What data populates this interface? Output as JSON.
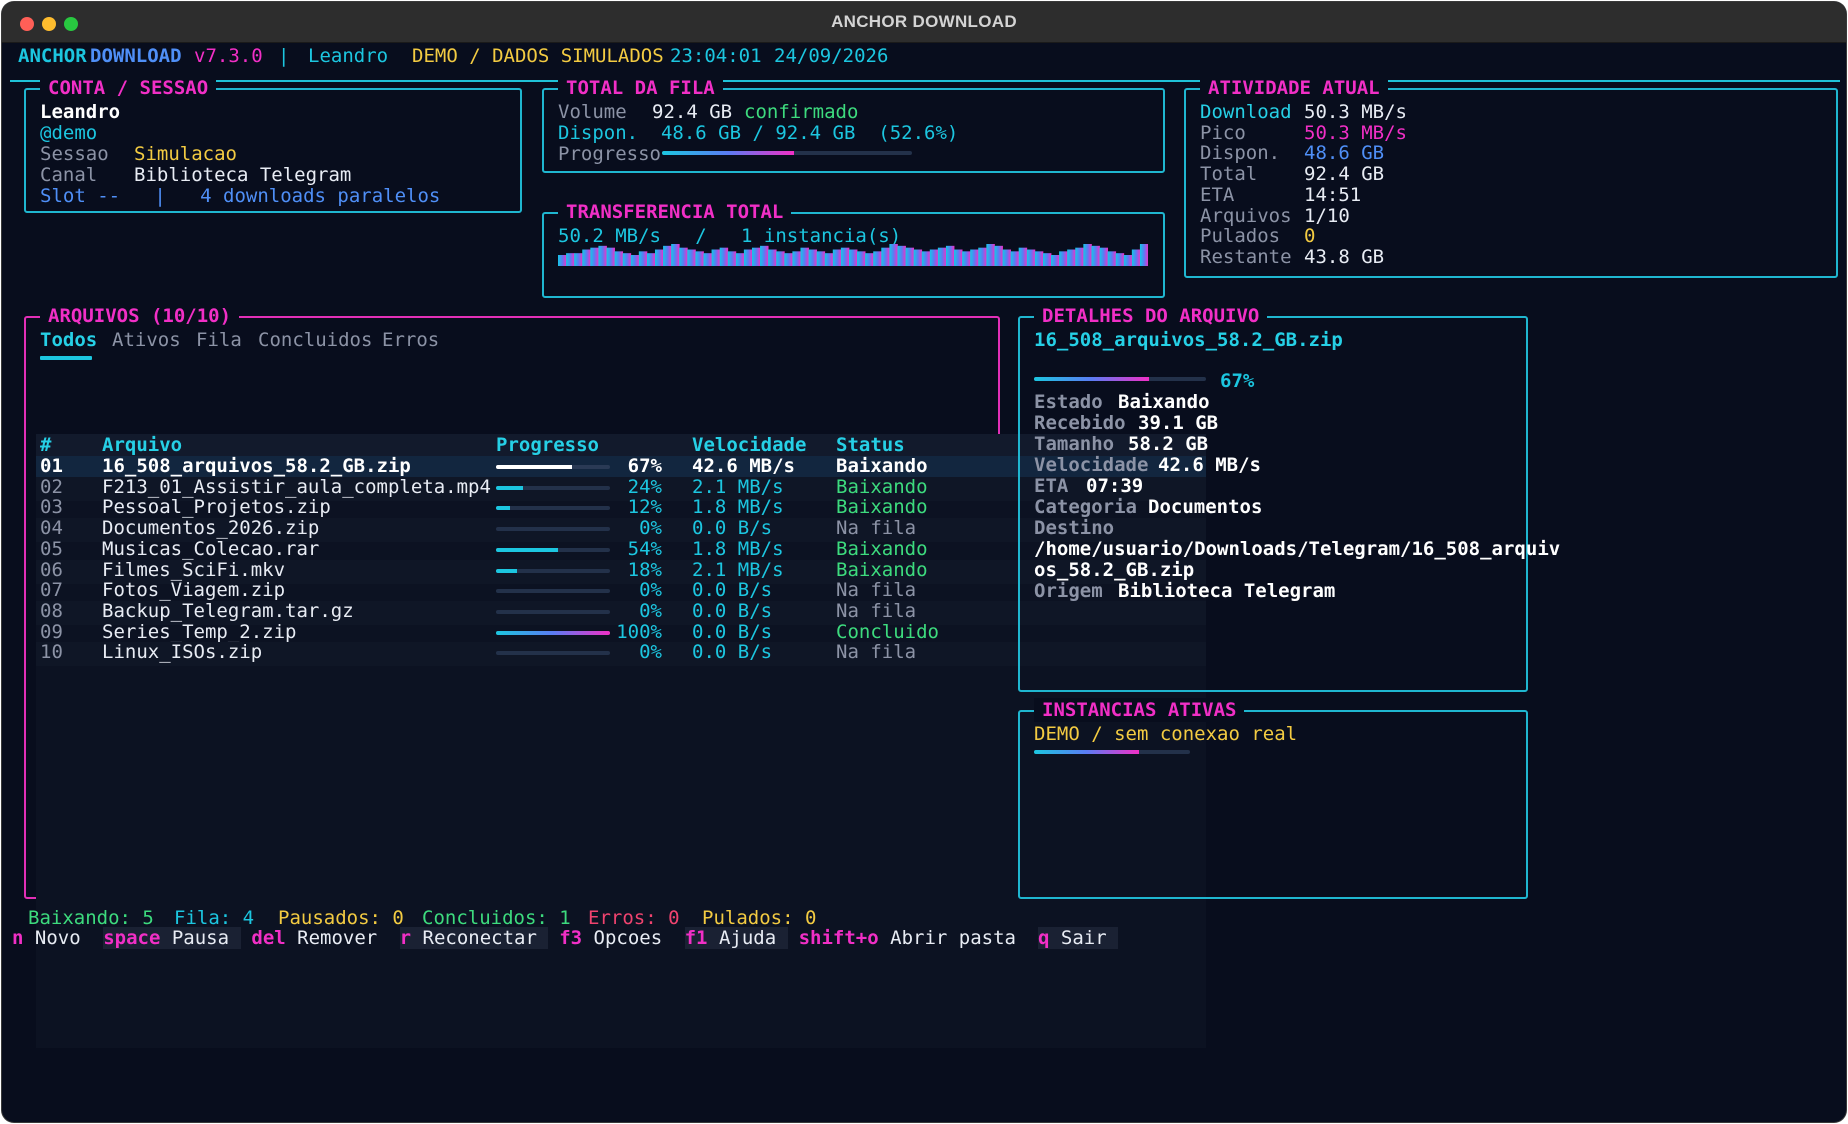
{
  "window": {
    "title": "ANCHOR DOWNLOAD"
  },
  "header": {
    "app_word1": "ANCHOR",
    "app_word2": "DOWNLOAD",
    "version": "v7.3.0",
    "separator": "|",
    "user": "Leandro",
    "mode": "DEMO / DADOS SIMULADOS",
    "time": "23:04:01",
    "date": "24/09/2026"
  },
  "account": {
    "title": "CONTA / SESSAO",
    "name": "Leandro",
    "handle": "@demo",
    "session_label": "Sessao",
    "session_value": "Simulacao",
    "channel_label": "Canal",
    "channel_value": "Biblioteca Telegram",
    "slot_text": "Slot --   |   4 downloads paralelos"
  },
  "queue_total": {
    "title": "TOTAL DA FILA",
    "volume_label": "Volume",
    "volume_value": "92.4 GB",
    "volume_status": "confirmado",
    "available_text": "Dispon.  48.6 GB / 92.4 GB  (52.6%)",
    "progress_label": "Progresso",
    "progress": 0.526
  },
  "transfer": {
    "title": "TRANSFERENCIA TOTAL",
    "speed_text": "50.2 MB/s   /   1 instancia(s)",
    "history": [
      6,
      7,
      7,
      9,
      10,
      11,
      10,
      8,
      7,
      6,
      8,
      7,
      9,
      11,
      12,
      10,
      9,
      8,
      7,
      9,
      10,
      8,
      7,
      9,
      10,
      11,
      9,
      8,
      7,
      8,
      10,
      9,
      8,
      7,
      9,
      10,
      9,
      8,
      7,
      8,
      10,
      12,
      11,
      10,
      9,
      8,
      9,
      10,
      11,
      9,
      8,
      9,
      10,
      12,
      11,
      9,
      8,
      10,
      9,
      8,
      7,
      6,
      8,
      9,
      10,
      12,
      11,
      10,
      8,
      7,
      6,
      9,
      12
    ]
  },
  "activity": {
    "title": "ATIVIDADE ATUAL",
    "rows": [
      {
        "label": "Download",
        "value": "50.3 MB/s",
        "label_color": "#26d0e6",
        "value_color": "#e8ecf4"
      },
      {
        "label": "Pico",
        "value": "50.3 MB/s",
        "label_color": "#8c93a6",
        "value_color": "#f12fc6"
      },
      {
        "label": "Dispon.",
        "value": "48.6 GB",
        "label_color": "#8c93a6",
        "value_color": "#4f8ff7"
      },
      {
        "label": "Total",
        "value": "92.4 GB",
        "label_color": "#8c93a6",
        "value_color": "#e8ecf4"
      },
      {
        "label": "ETA",
        "value": "14:51",
        "label_color": "#8c93a6",
        "value_color": "#e8ecf4"
      },
      {
        "label": "Arquivos",
        "value": "1/10",
        "label_color": "#8c93a6",
        "value_color": "#e8ecf4"
      },
      {
        "label": "Pulados",
        "value": "0",
        "label_color": "#8c93a6",
        "value_color": "#f3cb42"
      },
      {
        "label": "Restante",
        "value": "43.8 GB",
        "label_color": "#8c93a6",
        "value_color": "#e8ecf4"
      }
    ]
  },
  "files": {
    "title": "ARQUIVOS (10/10)",
    "tabs": [
      "Todos",
      "Ativos",
      "Fila",
      "Concluidos",
      "Erros"
    ],
    "active_tab": 0,
    "columns": {
      "num": "#",
      "name": "Arquivo",
      "progress": "Progresso",
      "speed": "Velocidade",
      "status": "Status"
    },
    "rows": [
      {
        "num": "01",
        "name": "16_508_arquivos_58.2_GB.zip",
        "pct": "67%",
        "progress": 0.67,
        "speed": "42.6 MB/s",
        "status": "Baixando"
      },
      {
        "num": "02",
        "name": "F213_01_Assistir_aula_completa.mp4",
        "pct": "24%",
        "progress": 0.24,
        "speed": "2.1 MB/s",
        "status": "Baixando"
      },
      {
        "num": "03",
        "name": "Pessoal_Projetos.zip",
        "pct": "12%",
        "progress": 0.12,
        "speed": "1.8 MB/s",
        "status": "Baixando"
      },
      {
        "num": "04",
        "name": "Documentos_2026.zip",
        "pct": "0%",
        "progress": 0,
        "speed": "0.0 B/s",
        "status": "Na fila"
      },
      {
        "num": "05",
        "name": "Musicas_Colecao.rar",
        "pct": "54%",
        "progress": 0.54,
        "speed": "1.8 MB/s",
        "status": "Baixando"
      },
      {
        "num": "06",
        "name": "Filmes_SciFi.mkv",
        "pct": "18%",
        "progress": 0.18,
        "speed": "2.1 MB/s",
        "status": "Baixando"
      },
      {
        "num": "07",
        "name": "Fotos_Viagem.zip",
        "pct": "0%",
        "progress": 0,
        "speed": "0.0 B/s",
        "status": "Na fila"
      },
      {
        "num": "08",
        "name": "Backup_Telegram.tar.gz",
        "pct": "0%",
        "progress": 0,
        "speed": "0.0 B/s",
        "status": "Na fila"
      },
      {
        "num": "09",
        "name": "Series_Temp_2.zip",
        "pct": "100%",
        "progress": 1.0,
        "speed": "0.0 B/s",
        "status": "Concluido"
      },
      {
        "num": "10",
        "name": "Linux_ISOs.zip",
        "pct": "0%",
        "progress": 0,
        "speed": "0.0 B/s",
        "status": "Na fila"
      }
    ]
  },
  "details": {
    "title": "DETALHES DO ARQUIVO",
    "filename": "16_508_arquivos_58.2_GB.zip",
    "pct": "67%",
    "progress": 0.67,
    "state_label": "Estado",
    "state_value": "Baixando",
    "received_label": "Recebido",
    "received_value": "39.1 GB",
    "size_label": "Tamanho",
    "size_value": "58.2 GB",
    "speed_label": "Velocidade",
    "speed_value": "42.6 MB/s",
    "eta_label": "ETA",
    "eta_value": "07:39",
    "category_label": "Categoria",
    "category_value": "Documentos",
    "dest_label": "Destino",
    "dest_line1": "/home/usuario/Downloads/Telegram/16_508_arquiv",
    "dest_line2": "os_58.2_GB.zip",
    "origin_label": "Origem",
    "origin_value": "Biblioteca Telegram"
  },
  "instances": {
    "title": "INSTANCIAS ATIVAS",
    "text": "DEMO / sem conexao real",
    "progress": 0.67
  },
  "statusbar": {
    "downloading": "Baixando: 5",
    "queue": "Fila: 4",
    "paused": "Pausados: 0",
    "completed": "Concluidos: 1",
    "errors": "Erros: 0",
    "skipped": "Pulados: 0"
  },
  "shortcuts": [
    {
      "key": "n",
      "label": "Novo"
    },
    {
      "key": "space",
      "label": "Pausa"
    },
    {
      "key": "del",
      "label": "Remover"
    },
    {
      "key": "r",
      "label": "Reconectar"
    },
    {
      "key": "f3",
      "label": "Opcoes"
    },
    {
      "key": "f1",
      "label": "Ajuda"
    },
    {
      "key": "shift+o",
      "label": "Abrir pasta"
    },
    {
      "key": "q",
      "label": "Sair"
    }
  ],
  "colors": {
    "bg": "#080d1d",
    "cyan": "#1cc6e0",
    "pink": "#f12fc6",
    "yellow": "#f3cb42",
    "green": "#3ddb7e",
    "blue": "#4f8ff7",
    "red": "#f0436f",
    "gray": "#8c93a6"
  }
}
